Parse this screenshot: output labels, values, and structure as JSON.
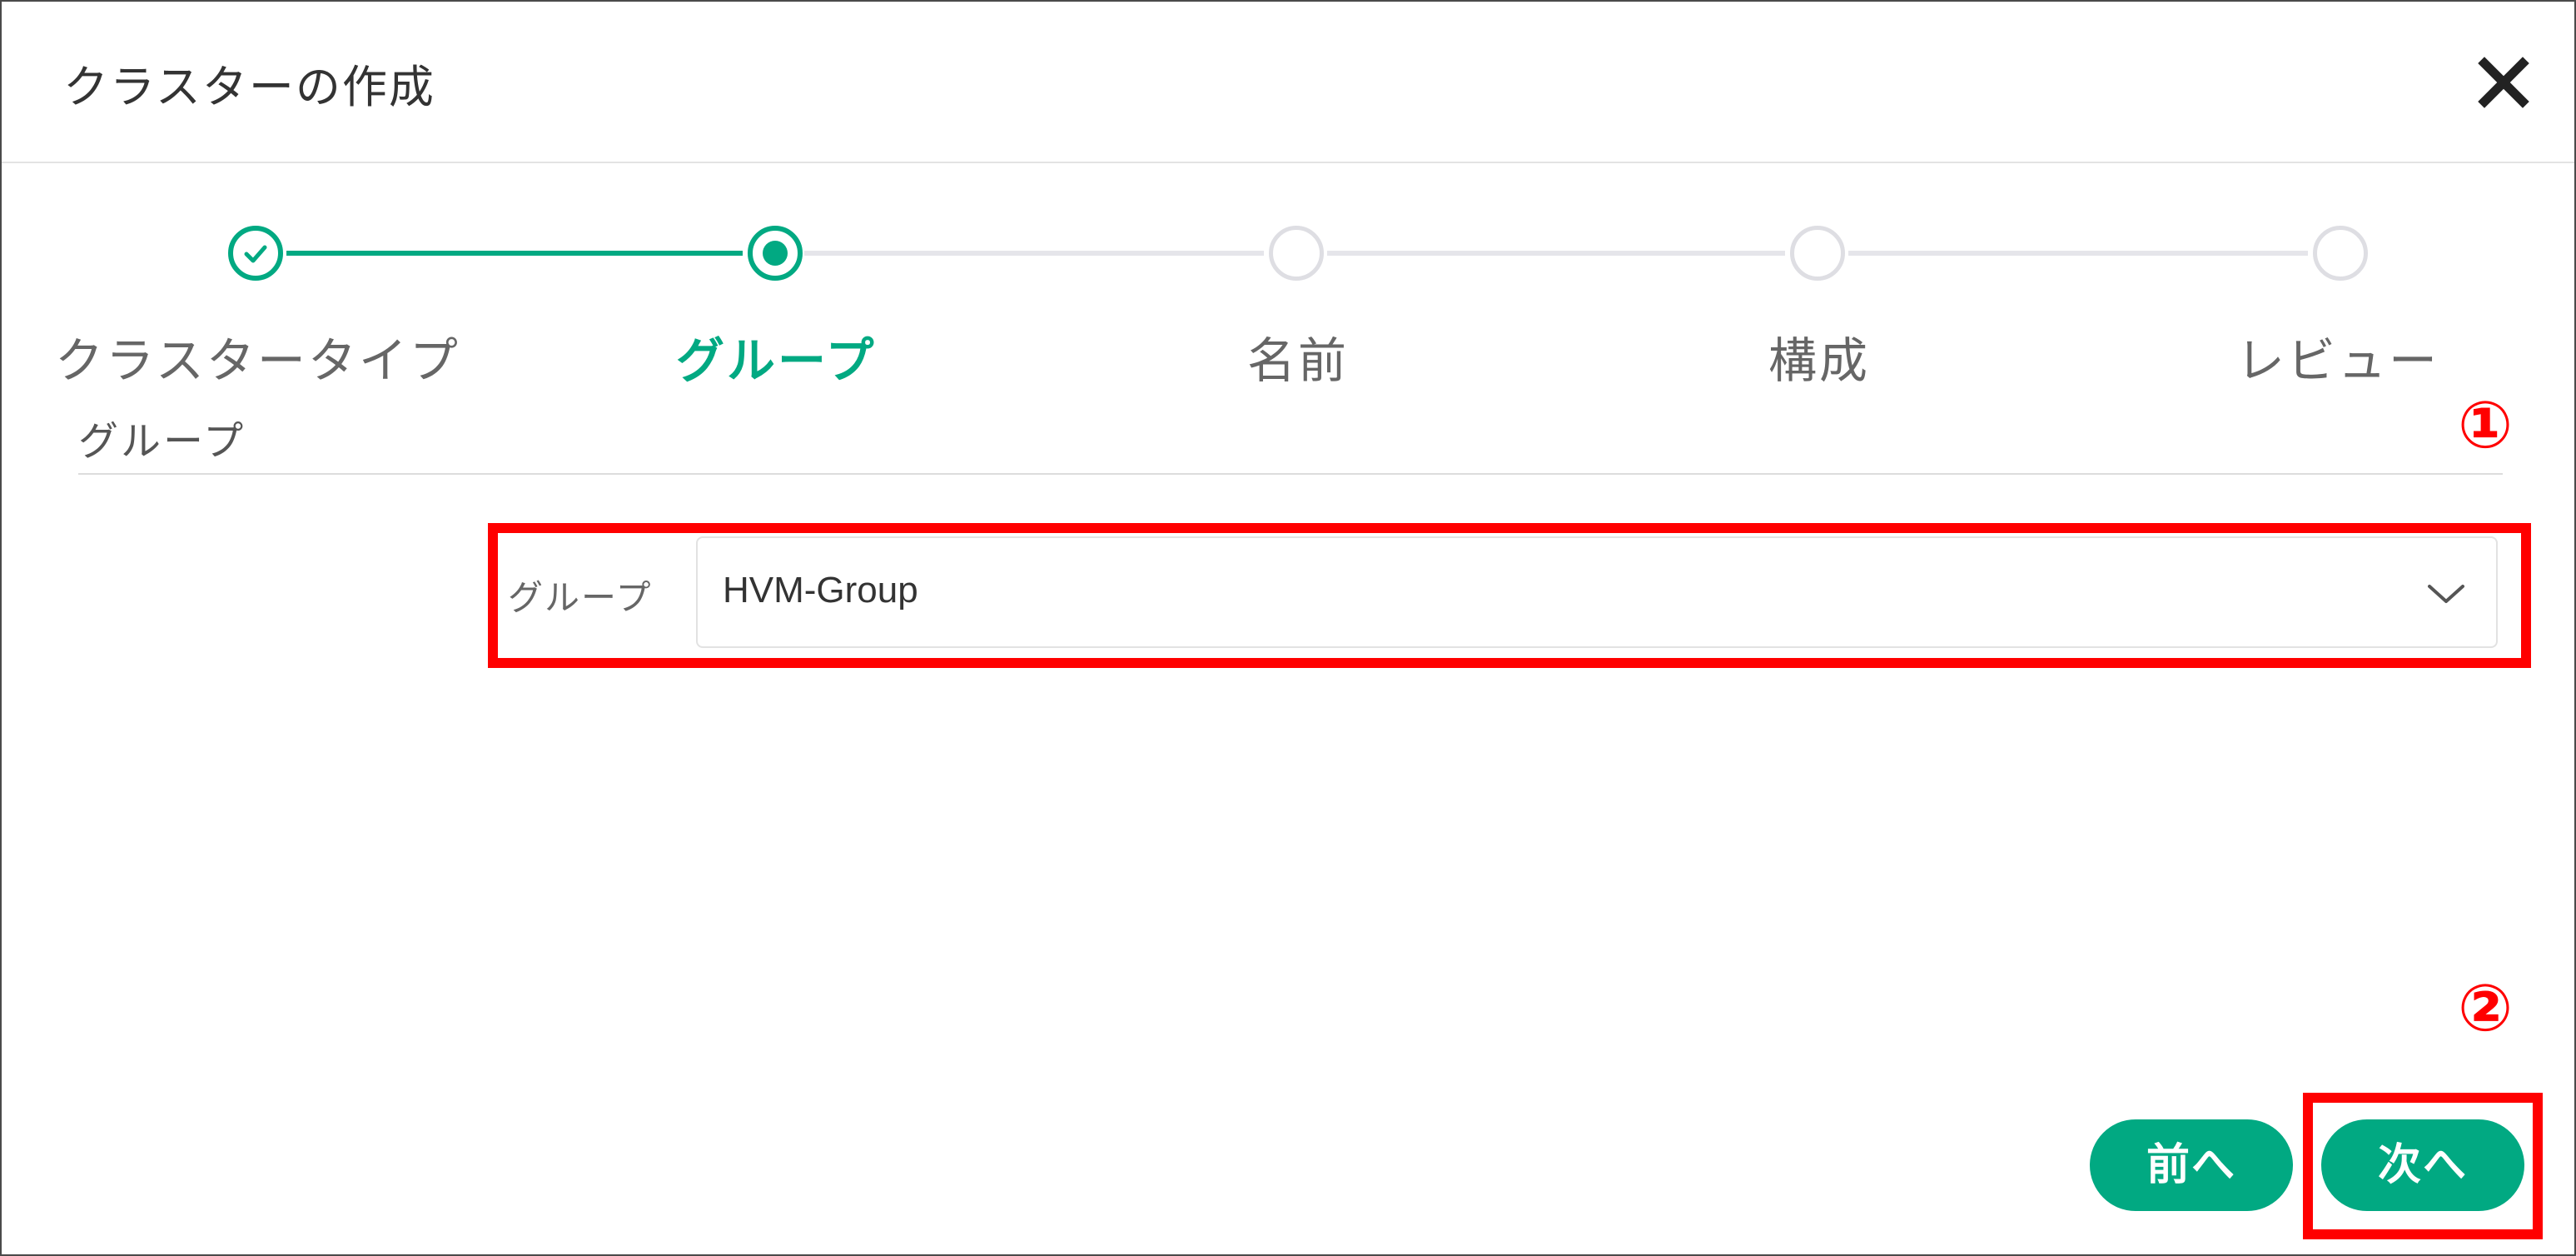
{
  "dialog": {
    "title": "クラスターの作成",
    "close_icon": "close-icon"
  },
  "stepper": {
    "steps": [
      {
        "label": "クラスタータイプ",
        "state": "done"
      },
      {
        "label": "グループ",
        "state": "active"
      },
      {
        "label": "名前",
        "state": "pending"
      },
      {
        "label": "構成",
        "state": "pending"
      },
      {
        "label": "レビュー",
        "state": "pending"
      }
    ]
  },
  "section": {
    "title": "グループ"
  },
  "group_field": {
    "label": "グループ",
    "value": "HVM-Group",
    "icon": "chevron-down-icon"
  },
  "buttons": {
    "prev_label": "前へ",
    "next_label": "次へ"
  },
  "annotations": {
    "callout_1": "①",
    "callout_2": "②",
    "highlight_color": "#ff0000"
  },
  "colors": {
    "accent": "#01a982",
    "pending": "#dedee3"
  }
}
